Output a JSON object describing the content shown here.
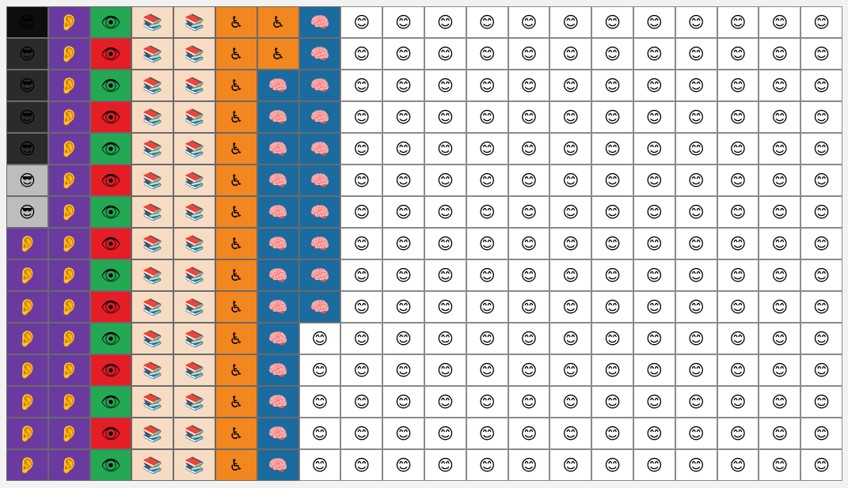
{
  "palette": {
    "black": "#0e0e0e",
    "dark": "#2b2b2b",
    "grey": "#bdbdbd",
    "purple": "#6b3aa1",
    "green": "#23a853",
    "red": "#e51d25",
    "peach": "#f7dcc4",
    "orange": "#f2861f",
    "blue": "#1b6b9e",
    "white": "#ffffff"
  },
  "icons": {
    "sunglasses-face": "😎",
    "ear": "👂",
    "eye": "👁",
    "books": "📚",
    "wheelchair": "♿",
    "brain": "🧠",
    "smiley-face": "😊"
  },
  "grid": {
    "rows": 15,
    "cols": 20,
    "cells": [
      [
        [
          "black",
          "sunglasses-face"
        ],
        [
          "purple",
          "ear"
        ],
        [
          "green",
          "eye"
        ],
        [
          "peach",
          "books"
        ],
        [
          "peach",
          "books"
        ],
        [
          "orange",
          "wheelchair"
        ],
        [
          "orange",
          "wheelchair"
        ],
        [
          "blue",
          "brain"
        ],
        [
          "white",
          "smiley-face"
        ],
        [
          "white",
          "smiley-face"
        ],
        [
          "white",
          "smiley-face"
        ],
        [
          "white",
          "smiley-face"
        ],
        [
          "white",
          "smiley-face"
        ],
        [
          "white",
          "smiley-face"
        ],
        [
          "white",
          "smiley-face"
        ],
        [
          "white",
          "smiley-face"
        ],
        [
          "white",
          "smiley-face"
        ],
        [
          "white",
          "smiley-face"
        ],
        [
          "white",
          "smiley-face"
        ],
        [
          "white",
          "smiley-face"
        ]
      ],
      [
        [
          "dark",
          "sunglasses-face"
        ],
        [
          "purple",
          "ear"
        ],
        [
          "red",
          "eye"
        ],
        [
          "peach",
          "books"
        ],
        [
          "peach",
          "books"
        ],
        [
          "orange",
          "wheelchair"
        ],
        [
          "orange",
          "wheelchair"
        ],
        [
          "blue",
          "brain"
        ],
        [
          "white",
          "smiley-face"
        ],
        [
          "white",
          "smiley-face"
        ],
        [
          "white",
          "smiley-face"
        ],
        [
          "white",
          "smiley-face"
        ],
        [
          "white",
          "smiley-face"
        ],
        [
          "white",
          "smiley-face"
        ],
        [
          "white",
          "smiley-face"
        ],
        [
          "white",
          "smiley-face"
        ],
        [
          "white",
          "smiley-face"
        ],
        [
          "white",
          "smiley-face"
        ],
        [
          "white",
          "smiley-face"
        ],
        [
          "white",
          "smiley-face"
        ]
      ],
      [
        [
          "dark",
          "sunglasses-face"
        ],
        [
          "purple",
          "ear"
        ],
        [
          "green",
          "eye"
        ],
        [
          "peach",
          "books"
        ],
        [
          "peach",
          "books"
        ],
        [
          "orange",
          "wheelchair"
        ],
        [
          "blue",
          "brain"
        ],
        [
          "blue",
          "brain"
        ],
        [
          "white",
          "smiley-face"
        ],
        [
          "white",
          "smiley-face"
        ],
        [
          "white",
          "smiley-face"
        ],
        [
          "white",
          "smiley-face"
        ],
        [
          "white",
          "smiley-face"
        ],
        [
          "white",
          "smiley-face"
        ],
        [
          "white",
          "smiley-face"
        ],
        [
          "white",
          "smiley-face"
        ],
        [
          "white",
          "smiley-face"
        ],
        [
          "white",
          "smiley-face"
        ],
        [
          "white",
          "smiley-face"
        ],
        [
          "white",
          "smiley-face"
        ]
      ],
      [
        [
          "dark",
          "sunglasses-face"
        ],
        [
          "purple",
          "ear"
        ],
        [
          "red",
          "eye"
        ],
        [
          "peach",
          "books"
        ],
        [
          "peach",
          "books"
        ],
        [
          "orange",
          "wheelchair"
        ],
        [
          "blue",
          "brain"
        ],
        [
          "blue",
          "brain"
        ],
        [
          "white",
          "smiley-face"
        ],
        [
          "white",
          "smiley-face"
        ],
        [
          "white",
          "smiley-face"
        ],
        [
          "white",
          "smiley-face"
        ],
        [
          "white",
          "smiley-face"
        ],
        [
          "white",
          "smiley-face"
        ],
        [
          "white",
          "smiley-face"
        ],
        [
          "white",
          "smiley-face"
        ],
        [
          "white",
          "smiley-face"
        ],
        [
          "white",
          "smiley-face"
        ],
        [
          "white",
          "smiley-face"
        ],
        [
          "white",
          "smiley-face"
        ]
      ],
      [
        [
          "dark",
          "sunglasses-face"
        ],
        [
          "purple",
          "ear"
        ],
        [
          "green",
          "eye"
        ],
        [
          "peach",
          "books"
        ],
        [
          "peach",
          "books"
        ],
        [
          "orange",
          "wheelchair"
        ],
        [
          "blue",
          "brain"
        ],
        [
          "blue",
          "brain"
        ],
        [
          "white",
          "smiley-face"
        ],
        [
          "white",
          "smiley-face"
        ],
        [
          "white",
          "smiley-face"
        ],
        [
          "white",
          "smiley-face"
        ],
        [
          "white",
          "smiley-face"
        ],
        [
          "white",
          "smiley-face"
        ],
        [
          "white",
          "smiley-face"
        ],
        [
          "white",
          "smiley-face"
        ],
        [
          "white",
          "smiley-face"
        ],
        [
          "white",
          "smiley-face"
        ],
        [
          "white",
          "smiley-face"
        ],
        [
          "white",
          "smiley-face"
        ]
      ],
      [
        [
          "grey",
          "sunglasses-face"
        ],
        [
          "purple",
          "ear"
        ],
        [
          "red",
          "eye"
        ],
        [
          "peach",
          "books"
        ],
        [
          "peach",
          "books"
        ],
        [
          "orange",
          "wheelchair"
        ],
        [
          "blue",
          "brain"
        ],
        [
          "blue",
          "brain"
        ],
        [
          "white",
          "smiley-face"
        ],
        [
          "white",
          "smiley-face"
        ],
        [
          "white",
          "smiley-face"
        ],
        [
          "white",
          "smiley-face"
        ],
        [
          "white",
          "smiley-face"
        ],
        [
          "white",
          "smiley-face"
        ],
        [
          "white",
          "smiley-face"
        ],
        [
          "white",
          "smiley-face"
        ],
        [
          "white",
          "smiley-face"
        ],
        [
          "white",
          "smiley-face"
        ],
        [
          "white",
          "smiley-face"
        ],
        [
          "white",
          "smiley-face"
        ]
      ],
      [
        [
          "grey",
          "sunglasses-face"
        ],
        [
          "purple",
          "ear"
        ],
        [
          "green",
          "eye"
        ],
        [
          "peach",
          "books"
        ],
        [
          "peach",
          "books"
        ],
        [
          "orange",
          "wheelchair"
        ],
        [
          "blue",
          "brain"
        ],
        [
          "blue",
          "brain"
        ],
        [
          "white",
          "smiley-face"
        ],
        [
          "white",
          "smiley-face"
        ],
        [
          "white",
          "smiley-face"
        ],
        [
          "white",
          "smiley-face"
        ],
        [
          "white",
          "smiley-face"
        ],
        [
          "white",
          "smiley-face"
        ],
        [
          "white",
          "smiley-face"
        ],
        [
          "white",
          "smiley-face"
        ],
        [
          "white",
          "smiley-face"
        ],
        [
          "white",
          "smiley-face"
        ],
        [
          "white",
          "smiley-face"
        ],
        [
          "white",
          "smiley-face"
        ]
      ],
      [
        [
          "purple",
          "ear"
        ],
        [
          "purple",
          "ear"
        ],
        [
          "red",
          "eye"
        ],
        [
          "peach",
          "books"
        ],
        [
          "peach",
          "books"
        ],
        [
          "orange",
          "wheelchair"
        ],
        [
          "blue",
          "brain"
        ],
        [
          "blue",
          "brain"
        ],
        [
          "white",
          "smiley-face"
        ],
        [
          "white",
          "smiley-face"
        ],
        [
          "white",
          "smiley-face"
        ],
        [
          "white",
          "smiley-face"
        ],
        [
          "white",
          "smiley-face"
        ],
        [
          "white",
          "smiley-face"
        ],
        [
          "white",
          "smiley-face"
        ],
        [
          "white",
          "smiley-face"
        ],
        [
          "white",
          "smiley-face"
        ],
        [
          "white",
          "smiley-face"
        ],
        [
          "white",
          "smiley-face"
        ],
        [
          "white",
          "smiley-face"
        ]
      ],
      [
        [
          "purple",
          "ear"
        ],
        [
          "purple",
          "ear"
        ],
        [
          "green",
          "eye"
        ],
        [
          "peach",
          "books"
        ],
        [
          "peach",
          "books"
        ],
        [
          "orange",
          "wheelchair"
        ],
        [
          "blue",
          "brain"
        ],
        [
          "blue",
          "brain"
        ],
        [
          "white",
          "smiley-face"
        ],
        [
          "white",
          "smiley-face"
        ],
        [
          "white",
          "smiley-face"
        ],
        [
          "white",
          "smiley-face"
        ],
        [
          "white",
          "smiley-face"
        ],
        [
          "white",
          "smiley-face"
        ],
        [
          "white",
          "smiley-face"
        ],
        [
          "white",
          "smiley-face"
        ],
        [
          "white",
          "smiley-face"
        ],
        [
          "white",
          "smiley-face"
        ],
        [
          "white",
          "smiley-face"
        ],
        [
          "white",
          "smiley-face"
        ]
      ],
      [
        [
          "purple",
          "ear"
        ],
        [
          "purple",
          "ear"
        ],
        [
          "red",
          "eye"
        ],
        [
          "peach",
          "books"
        ],
        [
          "peach",
          "books"
        ],
        [
          "orange",
          "wheelchair"
        ],
        [
          "blue",
          "brain"
        ],
        [
          "blue",
          "brain"
        ],
        [
          "white",
          "smiley-face"
        ],
        [
          "white",
          "smiley-face"
        ],
        [
          "white",
          "smiley-face"
        ],
        [
          "white",
          "smiley-face"
        ],
        [
          "white",
          "smiley-face"
        ],
        [
          "white",
          "smiley-face"
        ],
        [
          "white",
          "smiley-face"
        ],
        [
          "white",
          "smiley-face"
        ],
        [
          "white",
          "smiley-face"
        ],
        [
          "white",
          "smiley-face"
        ],
        [
          "white",
          "smiley-face"
        ],
        [
          "white",
          "smiley-face"
        ]
      ],
      [
        [
          "purple",
          "ear"
        ],
        [
          "purple",
          "ear"
        ],
        [
          "green",
          "eye"
        ],
        [
          "peach",
          "books"
        ],
        [
          "peach",
          "books"
        ],
        [
          "orange",
          "wheelchair"
        ],
        [
          "blue",
          "brain"
        ],
        [
          "white",
          "smiley-face"
        ],
        [
          "white",
          "smiley-face"
        ],
        [
          "white",
          "smiley-face"
        ],
        [
          "white",
          "smiley-face"
        ],
        [
          "white",
          "smiley-face"
        ],
        [
          "white",
          "smiley-face"
        ],
        [
          "white",
          "smiley-face"
        ],
        [
          "white",
          "smiley-face"
        ],
        [
          "white",
          "smiley-face"
        ],
        [
          "white",
          "smiley-face"
        ],
        [
          "white",
          "smiley-face"
        ],
        [
          "white",
          "smiley-face"
        ],
        [
          "white",
          "smiley-face"
        ]
      ],
      [
        [
          "purple",
          "ear"
        ],
        [
          "purple",
          "ear"
        ],
        [
          "red",
          "eye"
        ],
        [
          "peach",
          "books"
        ],
        [
          "peach",
          "books"
        ],
        [
          "orange",
          "wheelchair"
        ],
        [
          "blue",
          "brain"
        ],
        [
          "white",
          "smiley-face"
        ],
        [
          "white",
          "smiley-face"
        ],
        [
          "white",
          "smiley-face"
        ],
        [
          "white",
          "smiley-face"
        ],
        [
          "white",
          "smiley-face"
        ],
        [
          "white",
          "smiley-face"
        ],
        [
          "white",
          "smiley-face"
        ],
        [
          "white",
          "smiley-face"
        ],
        [
          "white",
          "smiley-face"
        ],
        [
          "white",
          "smiley-face"
        ],
        [
          "white",
          "smiley-face"
        ],
        [
          "white",
          "smiley-face"
        ],
        [
          "white",
          "smiley-face"
        ]
      ],
      [
        [
          "purple",
          "ear"
        ],
        [
          "purple",
          "ear"
        ],
        [
          "green",
          "eye"
        ],
        [
          "peach",
          "books"
        ],
        [
          "peach",
          "books"
        ],
        [
          "orange",
          "wheelchair"
        ],
        [
          "blue",
          "brain"
        ],
        [
          "white",
          "smiley-face"
        ],
        [
          "white",
          "smiley-face"
        ],
        [
          "white",
          "smiley-face"
        ],
        [
          "white",
          "smiley-face"
        ],
        [
          "white",
          "smiley-face"
        ],
        [
          "white",
          "smiley-face"
        ],
        [
          "white",
          "smiley-face"
        ],
        [
          "white",
          "smiley-face"
        ],
        [
          "white",
          "smiley-face"
        ],
        [
          "white",
          "smiley-face"
        ],
        [
          "white",
          "smiley-face"
        ],
        [
          "white",
          "smiley-face"
        ],
        [
          "white",
          "smiley-face"
        ]
      ],
      [
        [
          "purple",
          "ear"
        ],
        [
          "purple",
          "ear"
        ],
        [
          "red",
          "eye"
        ],
        [
          "peach",
          "books"
        ],
        [
          "peach",
          "books"
        ],
        [
          "orange",
          "wheelchair"
        ],
        [
          "blue",
          "brain"
        ],
        [
          "white",
          "smiley-face"
        ],
        [
          "white",
          "smiley-face"
        ],
        [
          "white",
          "smiley-face"
        ],
        [
          "white",
          "smiley-face"
        ],
        [
          "white",
          "smiley-face"
        ],
        [
          "white",
          "smiley-face"
        ],
        [
          "white",
          "smiley-face"
        ],
        [
          "white",
          "smiley-face"
        ],
        [
          "white",
          "smiley-face"
        ],
        [
          "white",
          "smiley-face"
        ],
        [
          "white",
          "smiley-face"
        ],
        [
          "white",
          "smiley-face"
        ],
        [
          "white",
          "smiley-face"
        ]
      ],
      [
        [
          "purple",
          "ear"
        ],
        [
          "purple",
          "ear"
        ],
        [
          "green",
          "eye"
        ],
        [
          "peach",
          "books"
        ],
        [
          "peach",
          "books"
        ],
        [
          "orange",
          "wheelchair"
        ],
        [
          "blue",
          "brain"
        ],
        [
          "white",
          "smiley-face"
        ],
        [
          "white",
          "smiley-face"
        ],
        [
          "white",
          "smiley-face"
        ],
        [
          "white",
          "smiley-face"
        ],
        [
          "white",
          "smiley-face"
        ],
        [
          "white",
          "smiley-face"
        ],
        [
          "white",
          "smiley-face"
        ],
        [
          "white",
          "smiley-face"
        ],
        [
          "white",
          "smiley-face"
        ],
        [
          "white",
          "smiley-face"
        ],
        [
          "white",
          "smiley-face"
        ],
        [
          "white",
          "smiley-face"
        ],
        [
          "white",
          "smiley-face"
        ]
      ]
    ]
  }
}
